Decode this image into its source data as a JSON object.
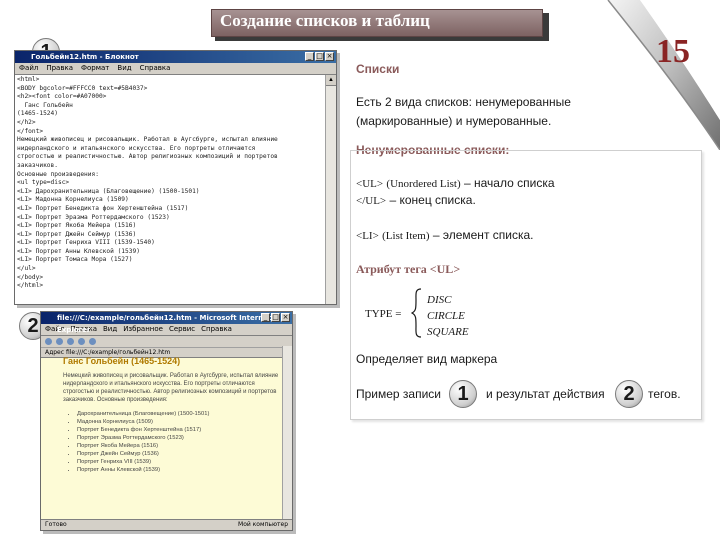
{
  "slide": {
    "title": "Создание списков и таблиц",
    "page_number": "15"
  },
  "badges": {
    "one": "1",
    "two": "2"
  },
  "notepad": {
    "title": "Гольбейн12.htm - Блокнот",
    "menu": [
      "Файл",
      "Правка",
      "Формат",
      "Вид",
      "Справка"
    ],
    "lines": [
      "<html>",
      "<BODY bgcolor=#FFFCC0 text=#5B4037>",
      "<h2><font color=#A07000>",
      "  Ганс Гольбейн",
      "(1465-1524)",
      "</h2>",
      "</font>",
      "Немецкий живописец и рисовальщик. Работал в Аугсбурге, испытал влияние",
      "нидерландского и итальянского искусства. Его портреты отличаются",
      "строгостью и реалистичностью. Автор религиозных композиций и портретов",
      "заказчиков.",
      "Основные произведения:",
      "<ul type=disc>",
      "<LI> Дарохранительница (Благовещение) (1500-1501)",
      "<LI> Мадонна Корнелиуса (1509)",
      "<LI> Портрет Бенедикта фон Хертенштейна (1517)",
      "<LI> Портрет Эразма Роттердамского (1523)",
      "<LI> Портрет Якоба Мейера (1516)",
      "<LI> Портрет Джейн Сеймур (1536)",
      "<LI> Портрет Генриха VIII (1539-1540)",
      "<LI> Портрет Анны Клевской (1539)",
      "<LI> Портрет Томаса Мора (1527)",
      "</ul>",
      "</body>",
      "</html>"
    ]
  },
  "ie": {
    "title": "file:///C:/example/гольбейн12.htm - Microsoft Internet Explorer",
    "menu": [
      "Файл",
      "Правка",
      "Вид",
      "Избранное",
      "Сервис",
      "Справка"
    ],
    "address": "Адрес  file:///C:/example/гольбейн12.htm",
    "heading": "Ганс Гольбейн (1465-1524)",
    "paragraph": "Немецкий живописец и рисовальщик. Работал в Аугсбурге, испытал влияние нидерландского и итальянского искусства. Его портреты отличаются строгостью и реалистичностью. Автор религиозных композиций и портретов заказчиков. Основные произведения:",
    "items": [
      "Дарохранительница (Благовещение) (1500-1501)",
      "Мадонна Корнелиуса (1509)",
      "Портрет Бенедикта фон Хертенштейна (1517)",
      "Портрет Эразма Роттердамского (1523)",
      "Портрет Якоба Мейера (1516)",
      "Портрет Джейн Сеймур (1536)",
      "Портрет Генриха VIII (1539)",
      "Портрет Анны Клевской (1539)"
    ],
    "status_left": "Готово",
    "status_right": "Мой компьютер"
  },
  "right": {
    "heading_lists": "Списки",
    "intro": "Есть 2 вида списков: ненумерованные (маркированные) и нумерованные.",
    "heading_unordered": "Ненумерованные списки:",
    "ul_open_tag": "<UL>",
    "ul_open_term": "(Unordered List)",
    "ul_open_desc": "– начало списка",
    "ul_close_tag": "</UL>",
    "ul_close_desc": "– конец списка.",
    "li_tag": "<LI>",
    "li_term": "(List Item)",
    "li_desc": "– элемент списка.",
    "attr_heading": "Атрибут тега <UL>",
    "type_label": "TYPE =",
    "type_values": [
      "DISC",
      "CIRCLE",
      "SQUARE"
    ],
    "marker_text": "Определяет вид маркера",
    "example_prefix": "Пример записи",
    "example_middle": "и результат действия",
    "example_suffix": "тегов."
  }
}
